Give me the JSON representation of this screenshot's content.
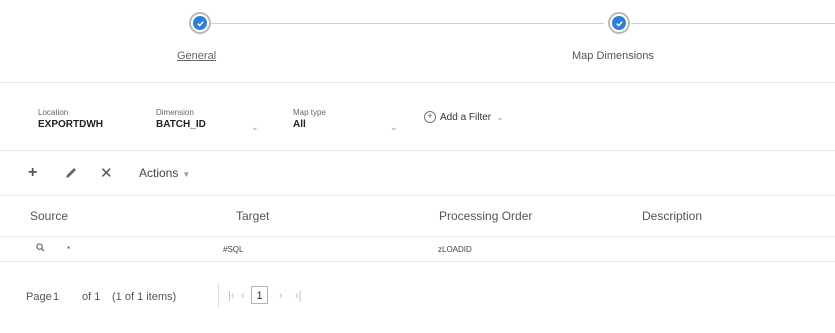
{
  "stepper": {
    "steps": [
      {
        "label": "General",
        "completed": true
      },
      {
        "label": "Map Dimensions",
        "completed": true
      }
    ]
  },
  "filters": {
    "location": {
      "label": "Location",
      "value": "EXPORTDWH"
    },
    "dimension": {
      "label": "Dimension",
      "value": "BATCH_ID"
    },
    "map_type": {
      "label": "Map type",
      "value": "All"
    },
    "add_filter_label": "Add a Filter"
  },
  "toolbar": {
    "add_icon": "plus-icon",
    "edit_icon": "pencil-icon",
    "delete_icon": "close-icon",
    "actions_label": "Actions"
  },
  "table": {
    "columns": [
      "Source",
      "Target",
      "Processing Order",
      "Description"
    ],
    "rows": [
      {
        "source": "*",
        "target": "#SQL",
        "processing_order": "zLOADID",
        "description": ""
      }
    ]
  },
  "pager": {
    "page_label": "Page",
    "page": "1",
    "of_text": "of 1",
    "items_text": "(1 of 1 items)",
    "current": "1"
  },
  "colors": {
    "accent": "#2d7fd3",
    "border": "#e7e7e7"
  }
}
